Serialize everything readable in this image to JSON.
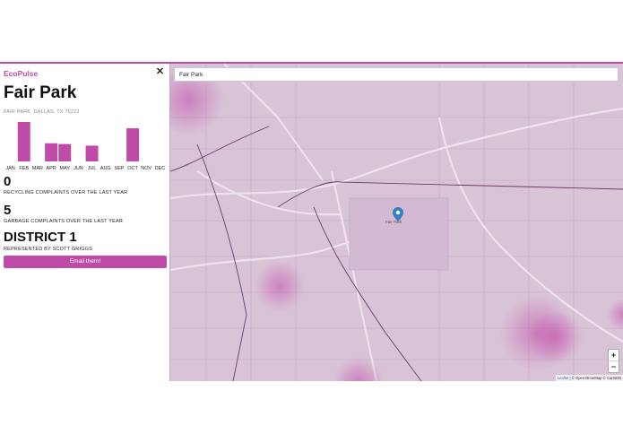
{
  "app": {
    "brand": "EcoPulse"
  },
  "sidebar": {
    "close_glyph": "✕",
    "title": "Fair Park",
    "address": "FAIR PARK, DALLAS, TX 75223",
    "chart_data": {
      "type": "bar",
      "categories": [
        "JAN",
        "FEB",
        "MAR",
        "APR",
        "MAY",
        "JUN",
        "JUL",
        "AUG",
        "SEP",
        "OCT",
        "NOV",
        "DEC"
      ],
      "values": [
        0,
        5,
        0,
        2.3,
        2.2,
        0,
        2,
        0,
        0,
        4.2,
        0,
        0
      ],
      "ylim": [
        0,
        5
      ],
      "color": "#c04aa8"
    },
    "recycling": {
      "value": "0",
      "label": "RECYCLING COMPLAINTS OVER THE LAST YEAR"
    },
    "garbage": {
      "value": "5",
      "label": "GARBAGE COMPLAINTS OVER THE LAST YEAR"
    },
    "district": {
      "value": "DISTRICT 1",
      "label": "REPRESENTED BY SCOTT GRIGGS"
    },
    "email_button": "Email them!"
  },
  "map": {
    "search_value": "Fair Park",
    "zoom_in": "+",
    "zoom_out": "−",
    "attribution_leaflet": "Leaflet",
    "attribution_osm": "© OpenStreetMap",
    "attribution_carto": "© CartoDB",
    "pin_label": "Fair Park",
    "accent": "#c04aa8",
    "base_color": "#d9c3d7"
  }
}
